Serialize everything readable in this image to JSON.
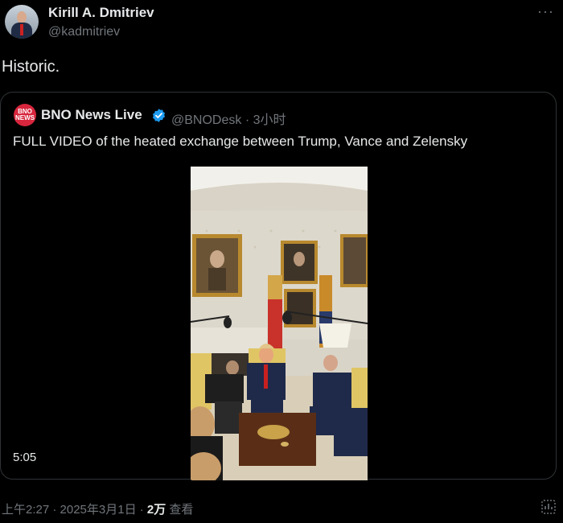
{
  "author": {
    "display_name": "Kirill A. Dmitriev",
    "handle": "@kadmitriev",
    "avatar_icon": "avatar-icon"
  },
  "more_icon": "more-icon",
  "tweet": {
    "text": "Historic."
  },
  "quoted": {
    "logo_text": "BNO NEWS",
    "display_name": "BNO News Live",
    "verified_icon": "verified-badge-icon",
    "handle_time": "@BNODesk · 3小时",
    "text": "FULL VIDEO of the heated exchange between Trump, Vance and Zelensky",
    "video": {
      "duration": "5:05"
    }
  },
  "meta": {
    "time_date": "上午2:27 · 2025年3月1日 · ",
    "views_count": "2万",
    "views_label": " 查看"
  },
  "colors": {
    "background": "#000000",
    "text": "#e7e9ea",
    "muted": "#71767b",
    "border": "#2f3336",
    "verified": "#1d9bf0",
    "bno_red": "#d7263d"
  }
}
